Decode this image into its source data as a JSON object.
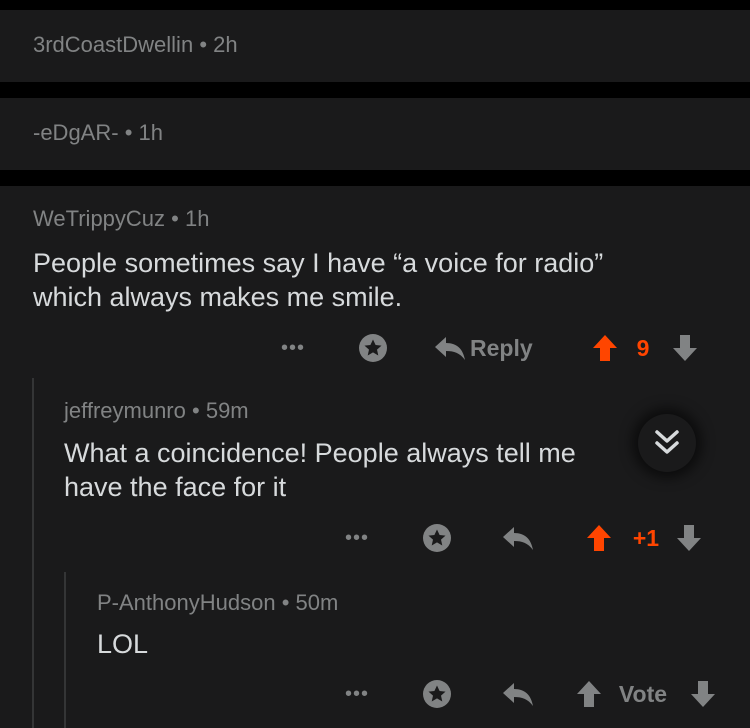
{
  "collapsed_comments": [
    {
      "author": "3rdCoastDwellin",
      "age": "2h"
    },
    {
      "author": "-eDgAR-",
      "age": "1h"
    }
  ],
  "comments": [
    {
      "author": "WeTrippyCuz",
      "age": "1h",
      "body_lines": [
        "People sometimes say I have “a voice for radio”",
        "which always makes me smile."
      ],
      "reply_label": "Reply",
      "score": "9"
    },
    {
      "author": "jeffreymunro",
      "age": "59m",
      "body_lines": [
        "What a coincidence! People always tell me",
        "have the face for it"
      ],
      "score": "+1"
    },
    {
      "author": "P-AnthonyHudson",
      "age": "50m",
      "body_lines": [
        "LOL"
      ],
      "score": "Vote"
    }
  ],
  "separator": "•",
  "more_label": "•••",
  "colors": {
    "background": "#000000",
    "panel": "#1a1a1b",
    "meta_text": "#818384",
    "body_text": "#d7dadc",
    "upvote_accent": "#ff4500"
  },
  "icons": [
    "more-options-icon",
    "award-icon",
    "reply-arrow-icon",
    "upvote-arrow-icon",
    "downvote-arrow-icon",
    "collapse-chevrons-icon"
  ]
}
